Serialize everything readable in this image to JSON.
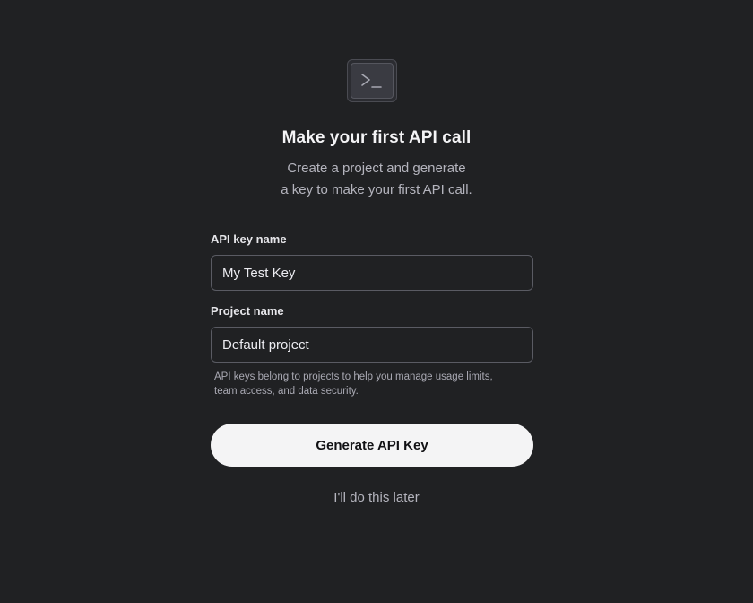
{
  "header": {
    "icon": "terminal-icon",
    "title": "Make your first API call",
    "subtitle_line1": "Create a project and generate",
    "subtitle_line2": "a key to make your first API call."
  },
  "form": {
    "api_key_label": "API key name",
    "api_key_value": "My Test Key",
    "project_label": "Project name",
    "project_value": "Default project",
    "help_line1": "API keys belong to projects to help you manage usage limits,",
    "help_line2": "team access, and data security."
  },
  "actions": {
    "generate_label": "Generate API Key",
    "later_label": "I'll do this later"
  },
  "colors": {
    "background": "#202123",
    "primary_button": "#f4f4f5",
    "text_muted": "#b4b4bd"
  }
}
